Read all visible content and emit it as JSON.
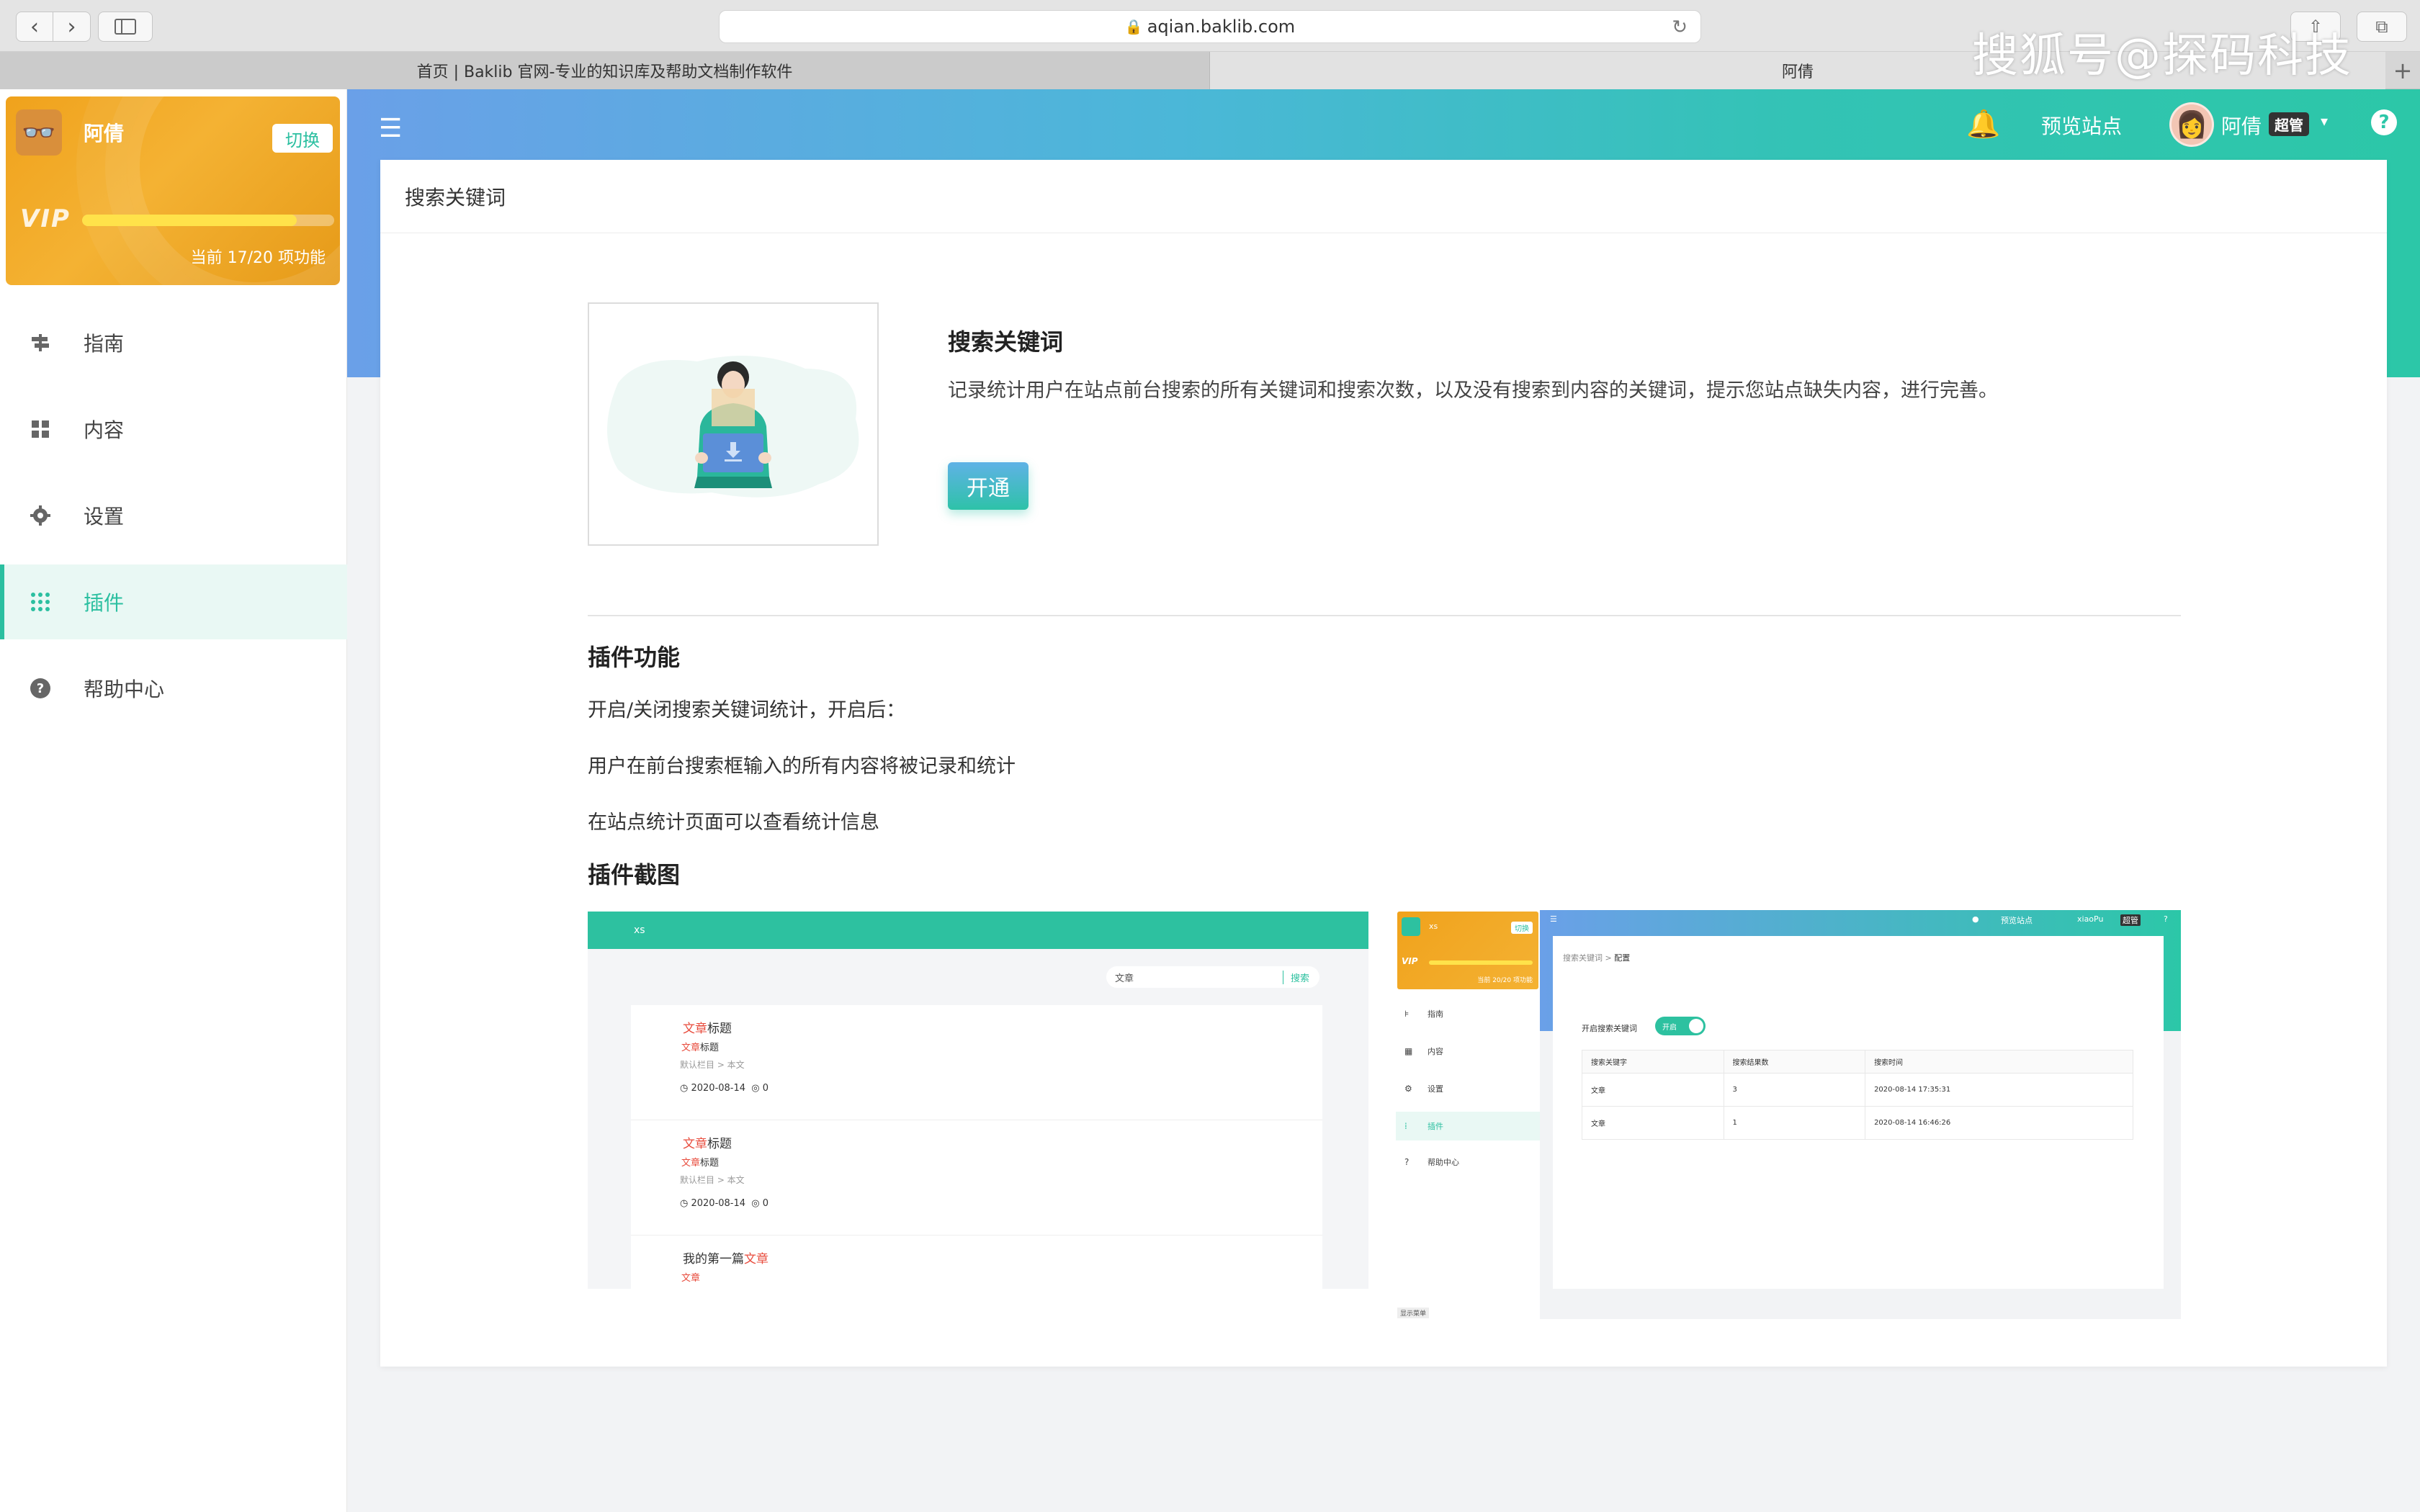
{
  "browser": {
    "url": "aqian.baklib.com",
    "tabs": [
      "首页 | Baklib 官网-专业的知识库及帮助文档制作软件",
      "阿倩"
    ]
  },
  "watermark": "搜狐号@探码科技",
  "sidebar": {
    "user_name": "阿倩",
    "switch_label": "切换",
    "vip_label": "VIP",
    "vip_status": "当前 17/20 项功能",
    "vip_progress": 0.85,
    "items": [
      {
        "label": "指南",
        "icon": "signpost-icon"
      },
      {
        "label": "内容",
        "icon": "grid-icon"
      },
      {
        "label": "设置",
        "icon": "gear-icon"
      },
      {
        "label": "插件",
        "icon": "dots-grid-icon",
        "active": true
      },
      {
        "label": "帮助中心",
        "icon": "question-circle-icon"
      }
    ]
  },
  "topbar": {
    "preview_label": "预览站点",
    "user_name": "阿倩",
    "role_badge": "超管"
  },
  "panel": {
    "title": "搜索关键词",
    "intro_title": "搜索关键词",
    "intro_desc": "记录统计用户在站点前台搜索的所有关键词和搜索次数，以及没有搜索到内容的关键词，提示您站点缺失内容，进行完善。",
    "enable_label": "开通",
    "features_title": "插件功能",
    "features": [
      "开启/关闭搜索关键词统计，开启后：",
      "用户在前台搜索框输入的所有内容将被记录和统计",
      "在站点统计页面可以查看统计信息"
    ],
    "screenshots_title": "插件截图"
  },
  "shot1": {
    "site_name": "xs",
    "search_value": "文章",
    "search_btn": "搜索",
    "posts": [
      {
        "title_hl": "文章",
        "title_rest": "标题",
        "sub_hl": "文章",
        "sub_rest": "标题",
        "category": "默认栏目 > 本文",
        "date": "2020-08-14",
        "count": "0"
      },
      {
        "title_hl": "文章",
        "title_rest": "标题",
        "sub_hl": "文章",
        "sub_rest": "标题",
        "category": "默认栏目 > 本文",
        "date": "2020-08-14",
        "count": "0"
      },
      {
        "title_pre": "我的第一篇",
        "title_hl": "文章",
        "sub_hl": "文章"
      }
    ]
  },
  "shot2": {
    "site_name": "xs",
    "switch_label": "切换",
    "vip_label": "VIP",
    "vip_status": "当前 20/20 项功能",
    "menu": [
      "指南",
      "内容",
      "设置",
      "插件",
      "帮助中心"
    ],
    "preview_label": "预览站点",
    "user_name": "xiaoPu",
    "role_badge": "超管",
    "breadcrumb_root": "搜索关键词",
    "breadcrumb_current": "配置",
    "toggle_label": "开启搜索关键词",
    "toggle_state": "开启",
    "table_headers": [
      "搜索关键字",
      "搜索结果数",
      "搜索时间"
    ],
    "table_rows": [
      [
        "文章",
        "3",
        "2020-08-14 17:35:31"
      ],
      [
        "文章",
        "1",
        "2020-08-14 16:46:26"
      ]
    ],
    "footer_label": "显示菜单"
  }
}
